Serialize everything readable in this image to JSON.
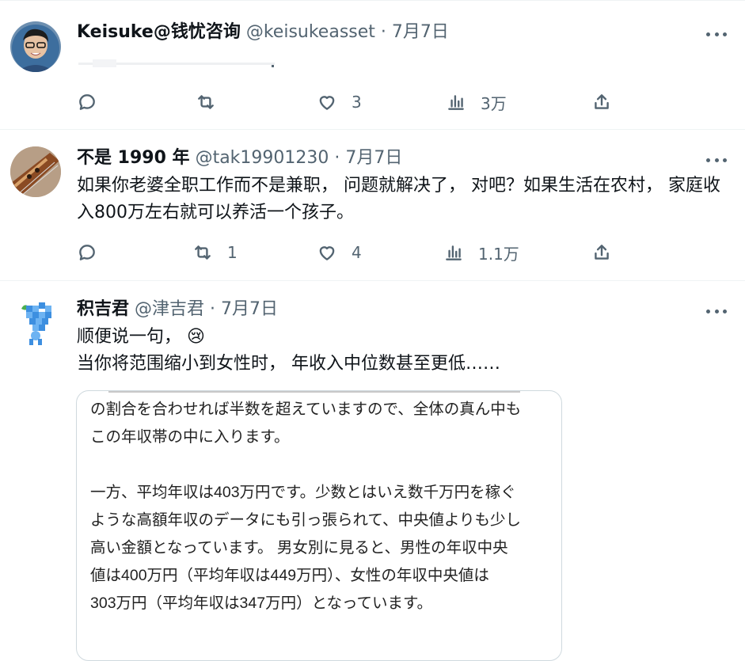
{
  "tweets": [
    {
      "name": "Keisuke@钱忧咨询",
      "handle": "@keisukeasset",
      "date": "7月7日",
      "text": "",
      "reply_count": "",
      "retweet_count": "",
      "like_count": "3",
      "view_count": "3万"
    },
    {
      "name": "不是 1990 年",
      "handle": "@tak19901230",
      "date": "7月7日",
      "text": "如果你老婆全职工作而不是兼职， 问题就解决了， 对吧？如果生活在农村， 家庭收入800万左右就可以养活一个孩子。",
      "reply_count": "",
      "retweet_count": "1",
      "like_count": "4",
      "view_count": "1.1万"
    },
    {
      "name": "积吉君",
      "handle": "@津吉君",
      "date": "7月7日",
      "text_line1": "顺便说一句，",
      "emoji": "😢",
      "text_line2": "当你将范围缩小到女性时， 年收入中位数甚至更低……",
      "card_text": "の割合を合わせれば半数を超えていますので、全体の真ん中も\nこの年収帯の中に入ります。\n\n一方、平均年収は403万円です。少数とはいえ数千万円を稼ぐ\nような高額年収のデータにも引っ張られて、中央値よりも少し\n高い金額となっています。 男女別に見ると、男性の年収中央\n値は400万円（平均年収は449万円）、女性の年収中央値は\n303万円（平均年収は347万円）となっています。"
    }
  ],
  "separator": "·",
  "icons": [
    "reply-icon",
    "retweet-icon",
    "like-icon",
    "views-icon",
    "share-icon",
    "more-icon"
  ],
  "colors": {
    "text": "#0f1419",
    "secondary": "#536471",
    "border": "#cfd9de"
  }
}
